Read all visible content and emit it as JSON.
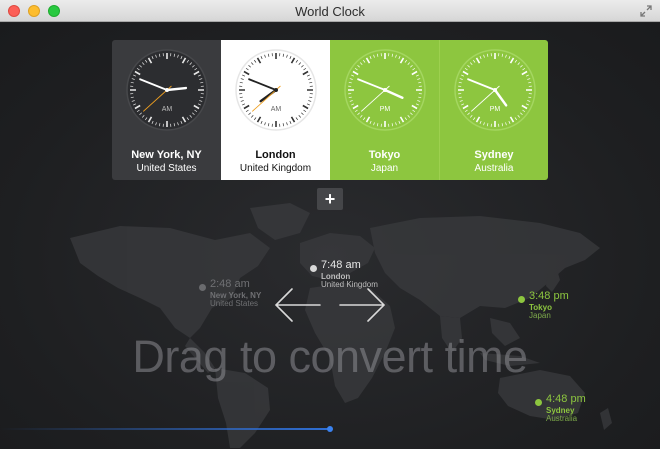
{
  "window": {
    "title": "World Clock"
  },
  "clocks": [
    {
      "city": "New York, NY",
      "country": "United States",
      "meridiem": "AM",
      "hour": 2,
      "minute": 48,
      "second": 38,
      "theme": "dark"
    },
    {
      "city": "London",
      "country": "United Kingdom",
      "meridiem": "AM",
      "hour": 7,
      "minute": 48,
      "second": 38,
      "theme": "light"
    },
    {
      "city": "Tokyo",
      "country": "Japan",
      "meridiem": "PM",
      "hour": 3,
      "minute": 48,
      "second": 38,
      "theme": "green"
    },
    {
      "city": "Sydney",
      "country": "Australia",
      "meridiem": "PM",
      "hour": 4,
      "minute": 48,
      "second": 38,
      "theme": "green"
    }
  ],
  "add_button": {
    "label": "+"
  },
  "pins": [
    {
      "time": "2:48 am",
      "city": "New York, NY",
      "country": "United States",
      "style": "gray"
    },
    {
      "time": "7:48 am",
      "city": "London",
      "country": "United Kingdom",
      "style": "white"
    },
    {
      "time": "3:48 pm",
      "city": "Tokyo",
      "country": "Japan",
      "style": "green"
    },
    {
      "time": "4:48 pm",
      "city": "Sydney",
      "country": "Australia",
      "style": "green"
    }
  ],
  "hint": "Drag to convert time",
  "colors": {
    "accent_green": "#8dc63f",
    "timeline_blue": "#2f6fd6"
  },
  "icons": {
    "fullscreen": "fullscreen-arrows-icon",
    "drag": "drag-arrows-icon"
  }
}
